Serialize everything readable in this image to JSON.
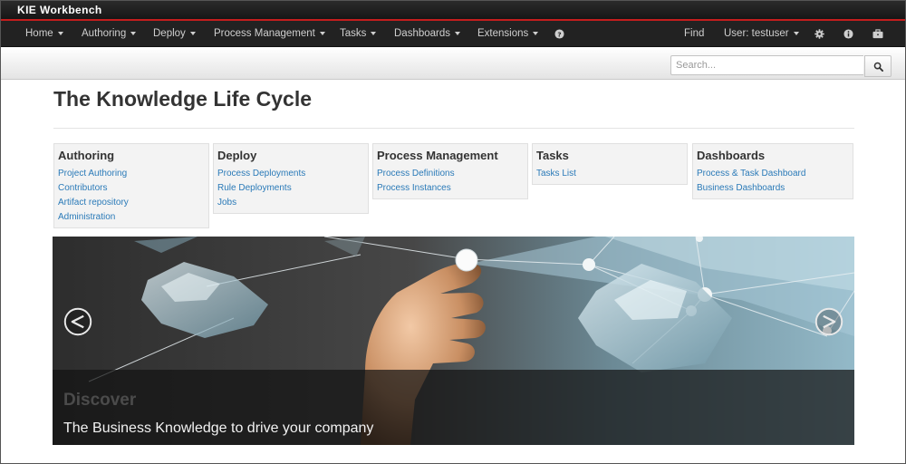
{
  "app": {
    "title": "KIE Workbench"
  },
  "nav": {
    "items": [
      {
        "label": "Home",
        "has_caret": true
      },
      {
        "label": "Authoring",
        "has_caret": true
      },
      {
        "label": "Deploy",
        "has_caret": true
      },
      {
        "label": "Process Management",
        "has_caret": true
      },
      {
        "label": "Tasks",
        "has_caret": true
      },
      {
        "label": "Dashboards",
        "has_caret": true
      },
      {
        "label": "Extensions",
        "has_caret": true
      }
    ],
    "help_icon": "question-circle-icon",
    "find_label": "Find",
    "user_label": "User: testuser",
    "settings_icon": "gear-icon",
    "info_icon": "info-icon",
    "briefcase_icon": "briefcase-icon"
  },
  "search": {
    "placeholder": "Search...",
    "value": "",
    "button_icon": "search-icon"
  },
  "page": {
    "title": "The Knowledge Life Cycle"
  },
  "sections": [
    {
      "title": "Authoring",
      "links": [
        "Project Authoring",
        "Contributors",
        "Artifact repository",
        "Administration"
      ]
    },
    {
      "title": "Deploy",
      "links": [
        "Process Deployments",
        "Rule Deployments",
        "Jobs"
      ]
    },
    {
      "title": "Process Management",
      "links": [
        "Process Definitions",
        "Process Instances"
      ]
    },
    {
      "title": "Tasks",
      "links": [
        "Tasks List"
      ]
    },
    {
      "title": "Dashboards",
      "links": [
        "Process & Task Dashboard",
        "Business Dashboards"
      ]
    }
  ],
  "carousel": {
    "caption_title": "Discover",
    "caption_text": "The Business Knowledge to drive your company",
    "prev_icon": "chevron-left-circle-icon",
    "next_icon": "chevron-right-circle-icon"
  },
  "colors": {
    "accent_red": "#c41d1d",
    "navbar_bg": "#222222",
    "link_blue": "#2a7ab8"
  }
}
